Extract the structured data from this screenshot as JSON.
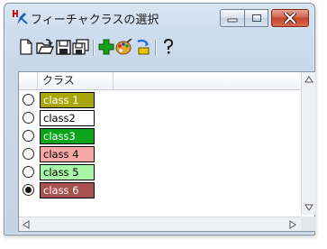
{
  "window": {
    "title": "フィーチャクラスの選択",
    "app_icon": "feature-class-icon"
  },
  "caption_buttons": [
    {
      "name": "minimize",
      "icon": "minimize-icon"
    },
    {
      "name": "maximize",
      "icon": "maximize-icon"
    },
    {
      "name": "close",
      "icon": "close-icon"
    }
  ],
  "toolbar": {
    "items": [
      {
        "icon": "new-file-icon"
      },
      {
        "icon": "open-folder-icon"
      },
      {
        "icon": "save-icon"
      },
      {
        "icon": "save-all-icon"
      },
      {
        "icon": "add-icon"
      },
      {
        "icon": "palette-icon"
      },
      {
        "icon": "paint-bucket-icon"
      },
      {
        "icon": "help-icon"
      }
    ]
  },
  "list": {
    "columns": [
      "",
      "クラス"
    ],
    "rows": [
      {
        "label": "class 1",
        "bg": "#a9a60c",
        "fg": "#ffffff",
        "selected": false
      },
      {
        "label": "class2",
        "bg": "#ffffff",
        "fg": "#000000",
        "selected": false
      },
      {
        "label": "class3",
        "bg": "#0aa51a",
        "fg": "#ffffff",
        "selected": false
      },
      {
        "label": "class 4",
        "bg": "#f7a8a4",
        "fg": "#000000",
        "selected": false
      },
      {
        "label": "class 5",
        "bg": "#a8f7a6",
        "fg": "#000000",
        "selected": false
      },
      {
        "label": "class 6",
        "bg": "#a8524f",
        "fg": "#ffffff",
        "selected": true
      }
    ]
  }
}
